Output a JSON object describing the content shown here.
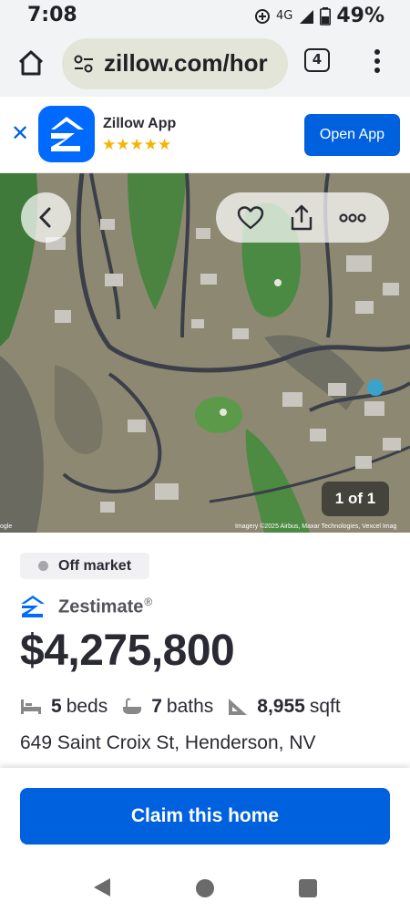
{
  "status_bar": {
    "time": "7:08",
    "network": "4G",
    "battery": "49%"
  },
  "browser": {
    "url": "zillow.com/hor",
    "tab_count": "4"
  },
  "app_banner": {
    "app_name": "Zillow App",
    "stars": "★★★★★",
    "open_label": "Open App",
    "close_glyph": "✕"
  },
  "photo": {
    "counter": "1 of 1",
    "credit": "Imagery ©2025 Airbus, Maxar Technologies, Vexcel Imag",
    "credit_left": "ogle"
  },
  "listing": {
    "status": "Off market",
    "zestimate_label": "Zestimate",
    "zestimate_reg": "®",
    "price": "$4,275,800",
    "beds_value": "5",
    "beds_label": "beds",
    "baths_value": "7",
    "baths_label": "baths",
    "sqft_value": "8,955",
    "sqft_label": "sqft",
    "address": "649 Saint Croix St, Henderson, NV"
  },
  "cta": {
    "claim_label": "Claim this home"
  },
  "colors": {
    "brand_blue": "#0061df",
    "star_gold": "#f5b400"
  }
}
